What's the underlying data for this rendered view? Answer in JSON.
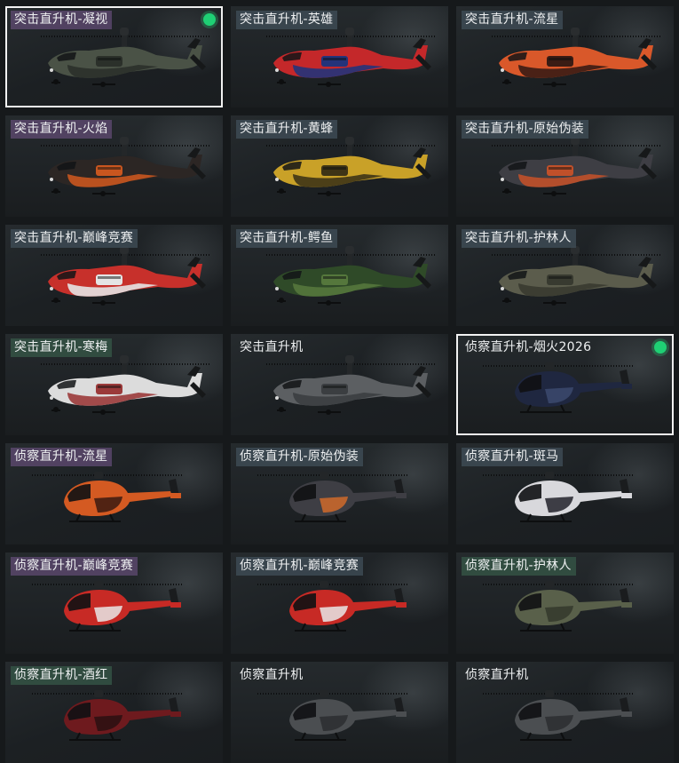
{
  "skins": [
    {
      "label": "突击直升机-凝视",
      "type": "attack",
      "tag": "purple",
      "selected": true,
      "equipped": true,
      "colors": [
        "#4a5246",
        "#2b302a"
      ]
    },
    {
      "label": "突击直升机-英雄",
      "type": "attack",
      "tag": "slate",
      "selected": false,
      "equipped": false,
      "colors": [
        "#c4282a",
        "#24337a"
      ]
    },
    {
      "label": "突击直升机-流星",
      "type": "attack",
      "tag": "slate",
      "selected": false,
      "equipped": false,
      "colors": [
        "#d9582a",
        "#3a1c14"
      ]
    },
    {
      "label": "突击直升机-火焰",
      "type": "attack",
      "tag": "purple",
      "selected": false,
      "equipped": false,
      "colors": [
        "#2c2624",
        "#c9561f"
      ]
    },
    {
      "label": "突击直升机-黄蜂",
      "type": "attack",
      "tag": "slate",
      "selected": false,
      "equipped": false,
      "colors": [
        "#c9a128",
        "#3e3416"
      ]
    },
    {
      "label": "突击直升机-原始伪装",
      "type": "attack",
      "tag": "slate",
      "selected": false,
      "equipped": false,
      "colors": [
        "#3e3e44",
        "#c0502a"
      ]
    },
    {
      "label": "突击直升机-巅峰竞赛",
      "type": "attack",
      "tag": "slate",
      "selected": false,
      "equipped": false,
      "colors": [
        "#c7302b",
        "#e4e4e4"
      ]
    },
    {
      "label": "突击直升机-鳄鱼",
      "type": "attack",
      "tag": "slate",
      "selected": false,
      "equipped": false,
      "colors": [
        "#2f4a28",
        "#55773c"
      ]
    },
    {
      "label": "突击直升机-护林人",
      "type": "attack",
      "tag": "slate",
      "selected": false,
      "equipped": false,
      "colors": [
        "#5b5c4c",
        "#383a30"
      ]
    },
    {
      "label": "突击直升机-寒梅",
      "type": "attack",
      "tag": "green",
      "selected": false,
      "equipped": false,
      "colors": [
        "#dcdcdc",
        "#9b3a3a"
      ]
    },
    {
      "label": "突击直升机",
      "type": "attack",
      "tag": "none",
      "selected": false,
      "equipped": false,
      "colors": [
        "#5c5f62",
        "#3b3e41"
      ]
    },
    {
      "label": "侦察直升机-烟火2026",
      "type": "scout",
      "tag": "none",
      "selected": true,
      "equipped": true,
      "colors": [
        "#1f2740",
        "#3c4a6e"
      ]
    },
    {
      "label": "侦察直升机-流星",
      "type": "scout",
      "tag": "purple",
      "selected": false,
      "equipped": false,
      "colors": [
        "#d45a22",
        "#3a1a10"
      ]
    },
    {
      "label": "侦察直升机-原始伪装",
      "type": "scout",
      "tag": "slate",
      "selected": false,
      "equipped": false,
      "colors": [
        "#3e3e44",
        "#d06a2a"
      ]
    },
    {
      "label": "侦察直升机-斑马",
      "type": "scout",
      "tag": "slate",
      "selected": false,
      "equipped": false,
      "colors": [
        "#d8d8dc",
        "#22222a"
      ]
    },
    {
      "label": "侦察直升机-巅峰竞赛",
      "type": "scout",
      "tag": "purple",
      "selected": false,
      "equipped": false,
      "colors": [
        "#c72a25",
        "#e8e8e8"
      ]
    },
    {
      "label": "侦察直升机-巅峰竞赛",
      "type": "scout",
      "tag": "slate",
      "selected": false,
      "equipped": false,
      "colors": [
        "#c72a25",
        "#e8e8e8"
      ]
    },
    {
      "label": "侦察直升机-护林人",
      "type": "scout",
      "tag": "green",
      "selected": false,
      "equipped": false,
      "colors": [
        "#59604a",
        "#34382c"
      ]
    },
    {
      "label": "侦察直升机-酒红",
      "type": "scout",
      "tag": "green",
      "selected": false,
      "equipped": false,
      "colors": [
        "#6e1a1e",
        "#2a1012"
      ]
    },
    {
      "label": "侦察直升机",
      "type": "scout",
      "tag": "none",
      "selected": false,
      "equipped": false,
      "colors": [
        "#4b4e51",
        "#2c2e30"
      ]
    },
    {
      "label": "侦察直升机",
      "type": "scout",
      "tag": "none",
      "selected": false,
      "equipped": false,
      "colors": [
        "#4b4e51",
        "#2c2e30"
      ]
    }
  ]
}
